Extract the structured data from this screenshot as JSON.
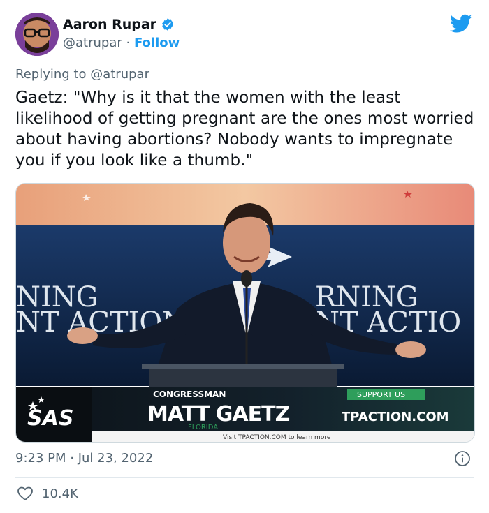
{
  "author": {
    "name": "Aaron Rupar",
    "handle": "@atrupar",
    "separator": "·",
    "follow_label": "Follow"
  },
  "reply": {
    "prefix": "Replying to",
    "mention": "@atrupar"
  },
  "tweet": {
    "text": "Gaetz: \"Why is it that the women with the least likelihood of getting pregnant are the ones most worried about having abortions? Nobody wants to impregnate you if you look like a thumb.\""
  },
  "media": {
    "banner_left_top": "NING",
    "banner_left_bottom": "NT ACTION",
    "banner_right_top": "RNING",
    "banner_right_bottom": "NT ACTIO",
    "logo": "SAS",
    "lower_third_title": "CONGRESSMAN",
    "lower_third_name": "MATT GAETZ",
    "lower_third_state": "FLORIDA",
    "support_label": "SUPPORT US",
    "site": "TPACTION.COM",
    "visit_text": "Visit TPACTION.COM to learn more"
  },
  "meta": {
    "timestamp": "9:23 PM · Jul 23, 2022",
    "likes": "10.4K"
  },
  "colors": {
    "twitter_blue": "#1d9bf0",
    "text_secondary": "#536471",
    "lower_third_green": "#2e9e5b"
  },
  "icons": {
    "verified": "verified-badge-icon",
    "bird": "twitter-bird-icon",
    "info": "info-icon",
    "heart": "heart-icon"
  }
}
